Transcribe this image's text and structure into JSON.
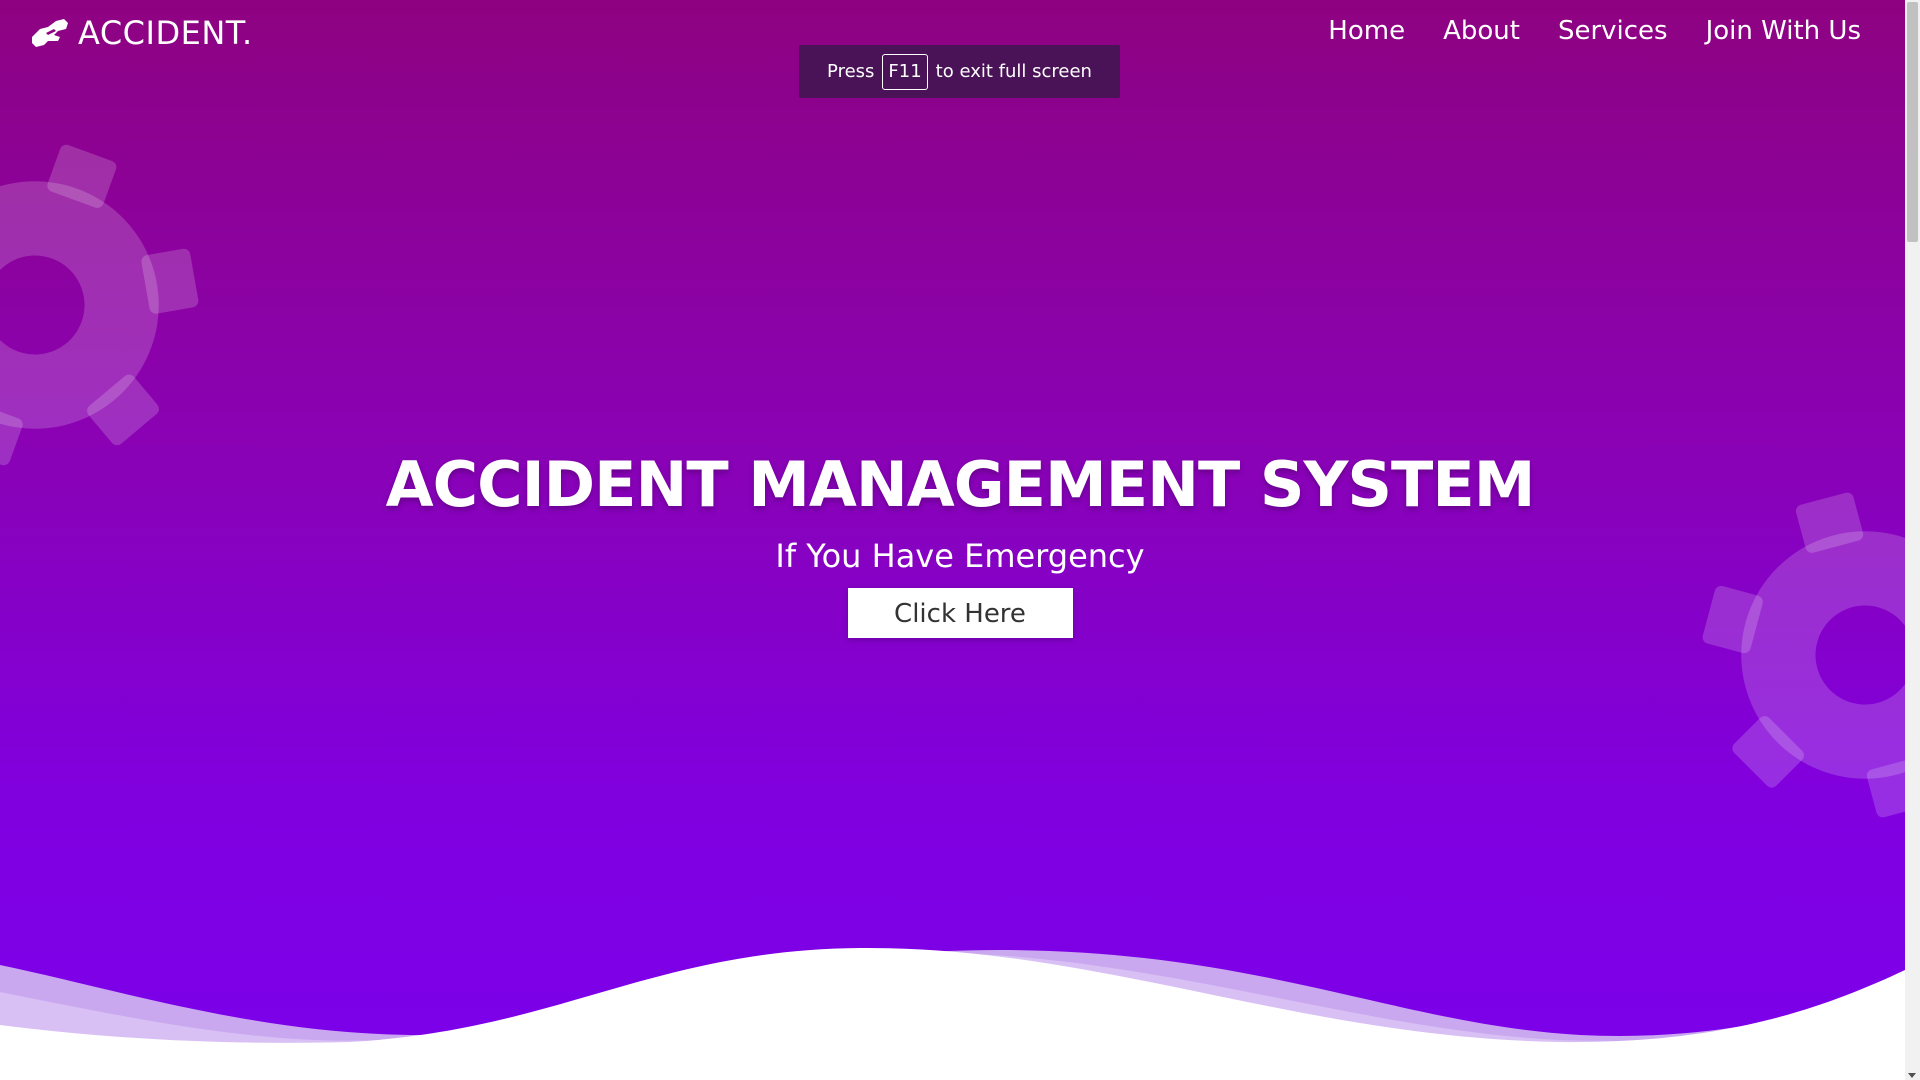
{
  "header": {
    "logo_text": "ACCIDENT.",
    "logo_icon": "handshake-icon",
    "nav": [
      {
        "label": "Home"
      },
      {
        "label": "About"
      },
      {
        "label": "Services"
      },
      {
        "label": "Join With Us"
      }
    ]
  },
  "fullscreen_notice": {
    "prefix": "Press",
    "key": "F11",
    "suffix": "to exit full screen"
  },
  "hero": {
    "title": "ACCIDENT MANAGEMENT SYSTEM",
    "subtitle": "If You Have Emergency",
    "cta_label": "Click Here",
    "decorations": [
      "gear-icon",
      "gear-icon"
    ]
  },
  "colors": {
    "gradient_top": "#8e0281",
    "gradient_bottom": "#7b00ea",
    "wave_light": "#c9a8f0",
    "text": "#ffffff",
    "cta_bg": "#ffffff",
    "cta_text": "#333333"
  }
}
